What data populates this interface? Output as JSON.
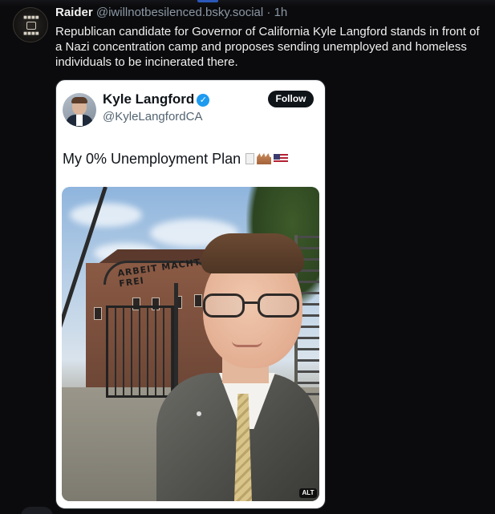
{
  "post": {
    "display_name": "Raider",
    "handle_time": "@iwillnotbesilenced.bsky.social · 1h",
    "text": "Republican candidate for Governor of California Kyle Langford stands in front of a Nazi concentration camp and proposes sending unemployed and homeless individuals to be incinerated there."
  },
  "embed": {
    "name": "Kyle Langford",
    "handle": "@KyleLangfordCA",
    "follow_label": "Follow",
    "tweet_text": "My 0% Unemployment Plan",
    "photo": {
      "sign_text": "ARBEIT MACHT FREI",
      "alt_badge": "ALT"
    }
  },
  "icons": [
    "avatar",
    "verified-badge-icon",
    "document-emoji-icon",
    "factory-emoji-icon",
    "us-flag-emoji-icon"
  ],
  "colors": {
    "background": "#0b0b0d",
    "verified": "#1d9bf0",
    "follow_button": "#0f1419"
  }
}
